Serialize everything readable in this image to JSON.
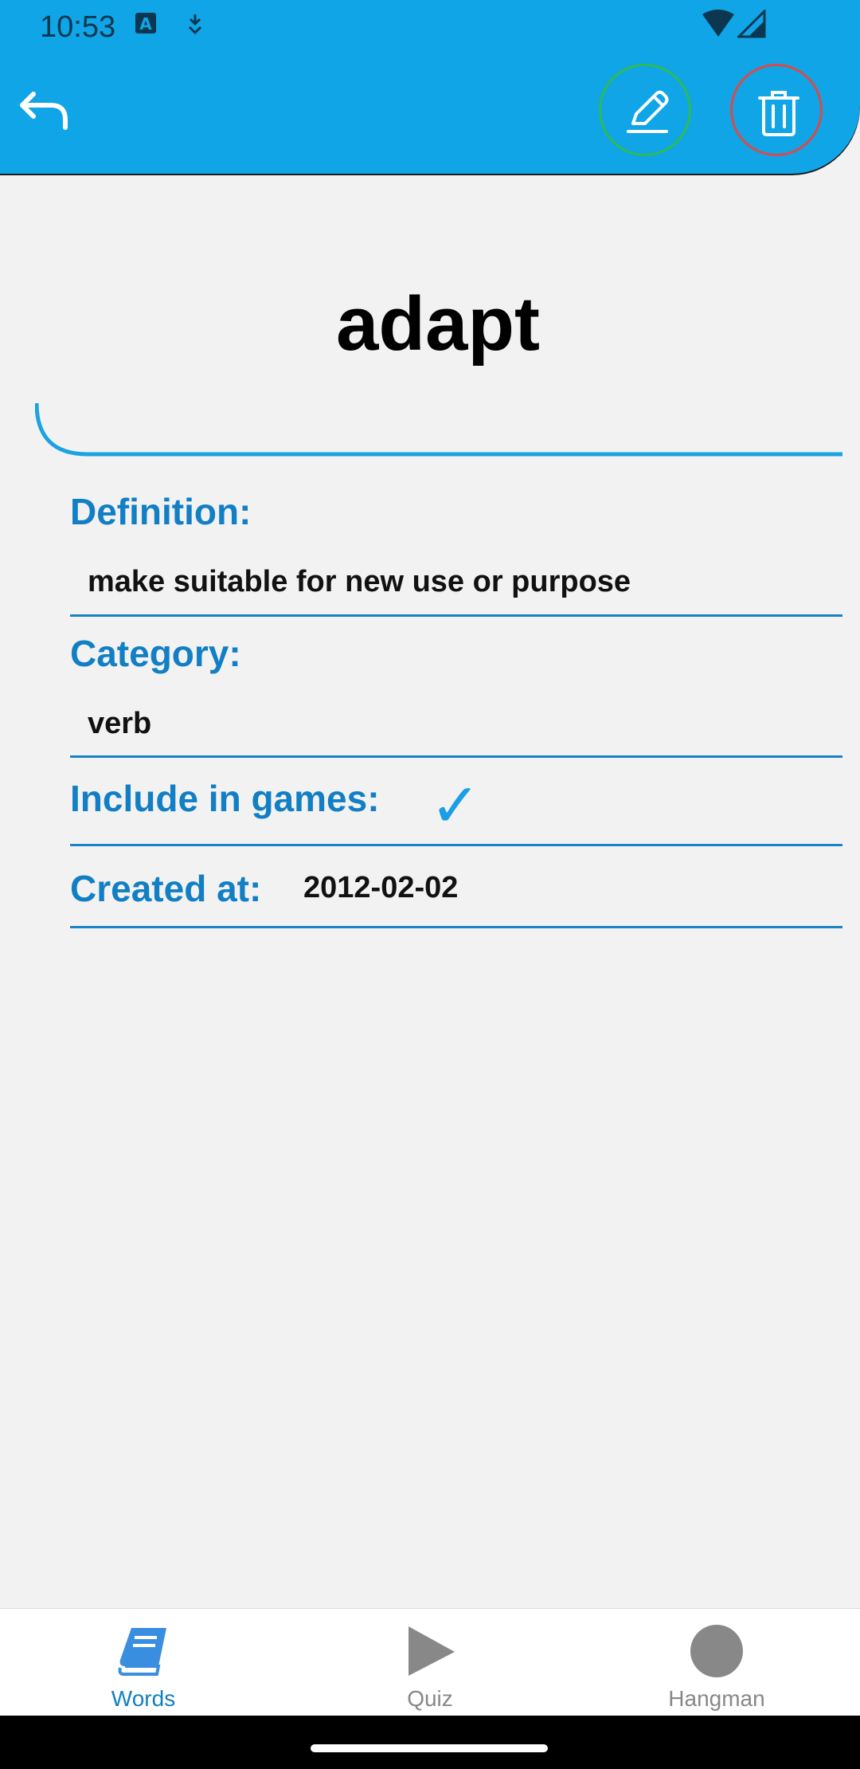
{
  "status_bar": {
    "time": "10:53",
    "icons": [
      "text-a-icon",
      "data-saver-icon",
      "wifi-icon",
      "signal-icon"
    ]
  },
  "toolbar": {
    "back_icon": "back-arrow-icon",
    "edit_icon": "pencil-icon",
    "delete_icon": "trash-icon",
    "colors": {
      "bar": "#0fa5e6",
      "edit_ring": "#2dbb55",
      "delete_ring": "#d94b4b"
    }
  },
  "word": {
    "title": "adapt",
    "definition_label": "Definition:",
    "definition_value": "make suitable for new use or purpose",
    "category_label": "Category:",
    "category_value": "verb",
    "games_label": "Include in games:",
    "games_value": "✓",
    "created_label": "Created at:",
    "created_value": "2012-02-02"
  },
  "bottom_nav": {
    "items": [
      {
        "label": "Words",
        "icon": "book-icon",
        "active": true
      },
      {
        "label": "Quiz",
        "icon": "play-icon",
        "active": false
      },
      {
        "label": "Hangman",
        "icon": "circle-icon",
        "active": false
      }
    ],
    "colors": {
      "active": "#127fc4",
      "inactive": "#888888"
    }
  }
}
